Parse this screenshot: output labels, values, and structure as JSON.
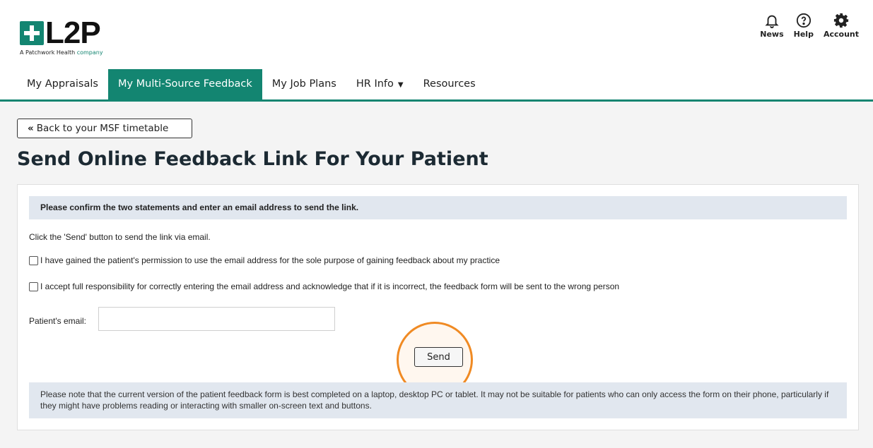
{
  "logo": {
    "text": "L2P",
    "tagline_prefix": "A Patchwork Health",
    "tagline_suffix": "company"
  },
  "top_icons": [
    {
      "label": "News",
      "icon": "bell-icon"
    },
    {
      "label": "Help",
      "icon": "help-circle-icon"
    },
    {
      "label": "Account",
      "icon": "gear-icon"
    }
  ],
  "nav": {
    "items": [
      {
        "label": "My Appraisals"
      },
      {
        "label": "My Multi-Source Feedback",
        "active": true
      },
      {
        "label": "My Job Plans"
      },
      {
        "label": "HR Info"
      },
      {
        "label": "Resources"
      }
    ]
  },
  "back_button": {
    "icon": "«",
    "label": "Back to your MSF timetable"
  },
  "page_title": "Send Online Feedback Link For Your Patient",
  "form": {
    "notice": "Please confirm the two statements and enter an email address to send the link.",
    "instruction": "Click the 'Send' button to send the link via email.",
    "checkbox_1": "I have gained the patient's permission to use the email address for the sole purpose of gaining feedback about my practice",
    "checkbox_2": "I accept full responsibility for correctly entering the email address and acknowledge that if it is incorrect, the feedback form will be sent to the wrong person",
    "email_label": "Patient's email:",
    "email_value": "",
    "send_label": "Send",
    "footnote": "Please note that the current version of the patient feedback form is best completed on a laptop, desktop PC or tablet. It may not be suitable for patients who can only access the form on their phone, particularly if they might have problems reading or interacting with smaller on-screen text and buttons."
  },
  "colors": {
    "brand": "#138571",
    "highlight_ring": "#f08a23",
    "notice_bg": "#e1e7ef"
  }
}
